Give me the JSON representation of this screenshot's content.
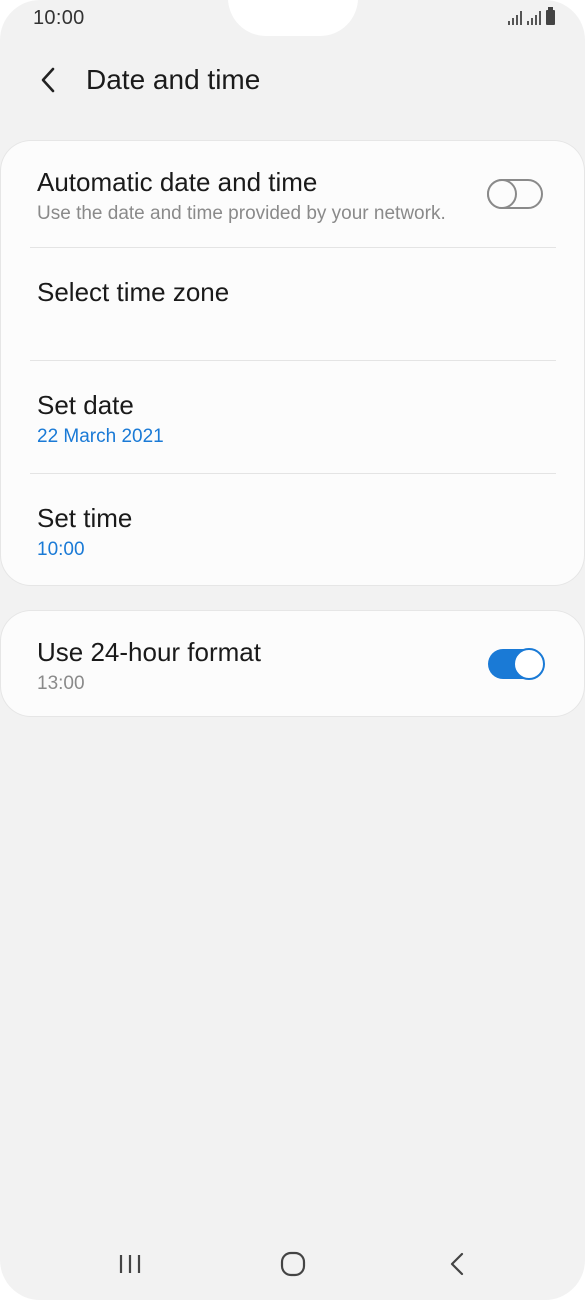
{
  "status_bar": {
    "time": "10:00",
    "icons": [
      "signal-icon",
      "signal-icon",
      "battery-icon"
    ]
  },
  "header": {
    "title": "Date and time",
    "back_icon": "chevron-left-icon"
  },
  "settings": {
    "automatic": {
      "title": "Automatic date and time",
      "subtitle": "Use the date and time provided by your network.",
      "enabled": false
    },
    "time_zone": {
      "title": "Select time zone"
    },
    "date": {
      "title": "Set date",
      "value": "22 March 2021"
    },
    "time": {
      "title": "Set time",
      "value": "10:00"
    },
    "format_24h": {
      "title": "Use 24-hour format",
      "subtitle": "13:00",
      "enabled": true
    }
  },
  "nav_bar": {
    "icons": [
      "recents-icon",
      "home-icon",
      "back-icon"
    ]
  },
  "colors": {
    "accent": "#1a7ad6",
    "background": "#f2f2f2",
    "card": "#fcfcfc"
  }
}
